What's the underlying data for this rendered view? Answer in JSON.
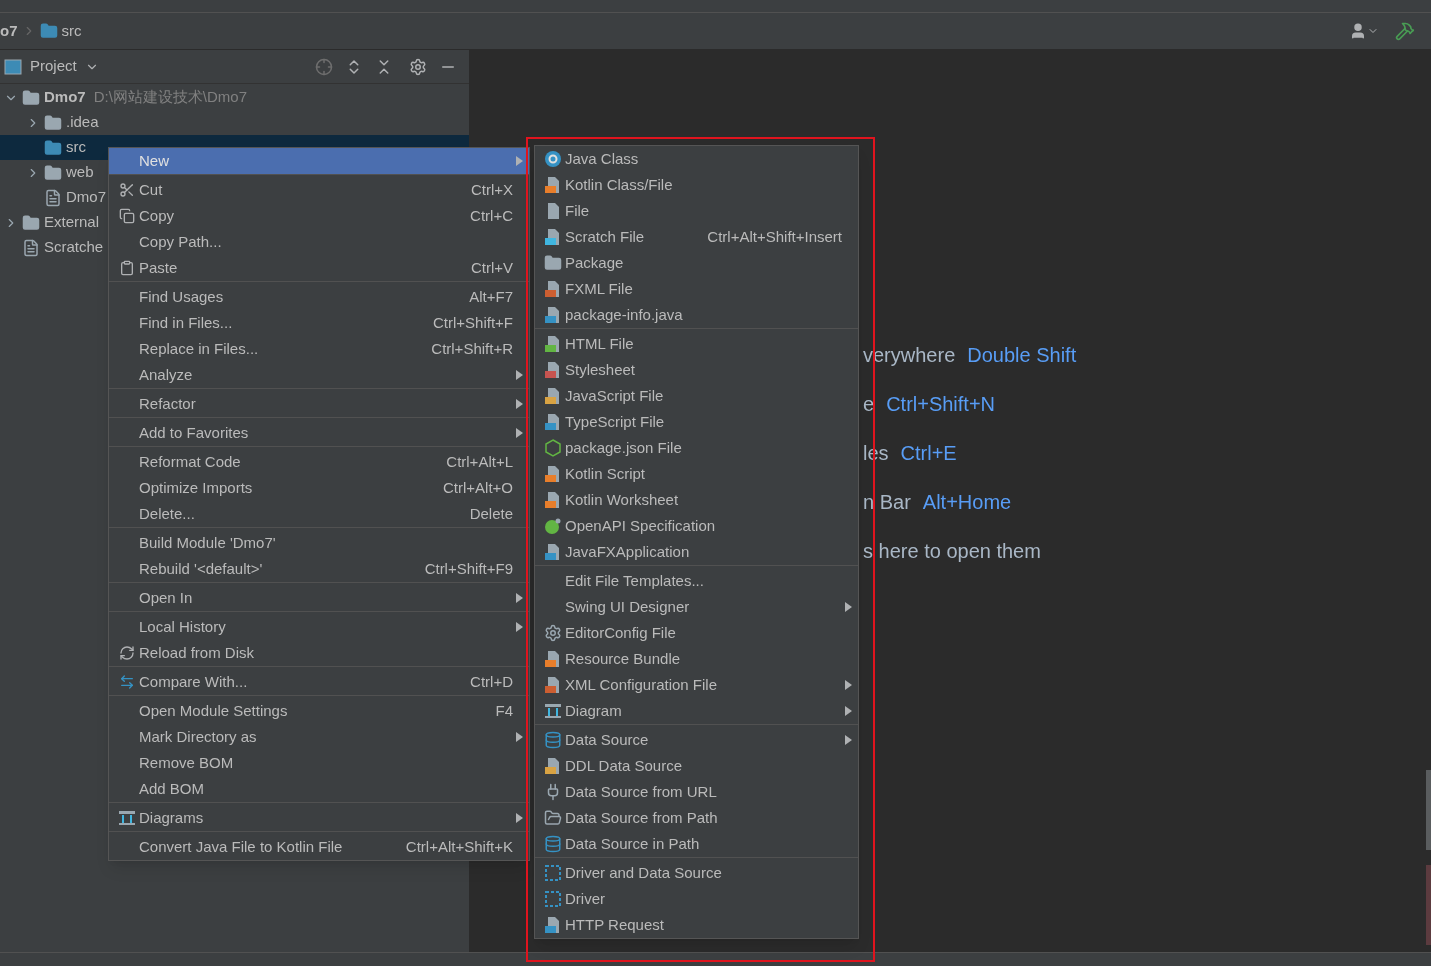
{
  "breadcrumb": [
    {
      "label": "o7",
      "bold": true
    },
    {
      "label": "src",
      "bold": false
    }
  ],
  "project_panel": {
    "title": "Project"
  },
  "tree": [
    {
      "label": "Dmo7",
      "path": "D:\\网站建设技术\\Dmo7",
      "expanded": true,
      "selected": false,
      "children": [
        {
          "label": ".idea",
          "expanded": false,
          "selected": false
        },
        {
          "label": "src",
          "selected": true
        },
        {
          "label": "web",
          "expanded": false,
          "selected": false
        },
        {
          "label": "Dmo7",
          "selected": false
        }
      ]
    },
    {
      "label": "External",
      "expanded": false,
      "selected": false
    },
    {
      "label": "Scratche",
      "selected": false
    }
  ],
  "context_menu": {
    "groups": [
      {
        "items": [
          {
            "label": "New",
            "submenu": true,
            "selected": true
          }
        ]
      },
      {
        "items": [
          {
            "label": "Cut",
            "shortcut": "Ctrl+X",
            "submenu": false,
            "selected": false
          },
          {
            "label": "Copy",
            "shortcut": "Ctrl+C",
            "submenu": false,
            "selected": false
          },
          {
            "label": "Copy Path...",
            "submenu": false,
            "selected": false
          },
          {
            "label": "Paste",
            "shortcut": "Ctrl+V",
            "submenu": false,
            "selected": false
          }
        ]
      },
      {
        "items": [
          {
            "label": "Find Usages",
            "shortcut": "Alt+F7",
            "submenu": false,
            "selected": false
          },
          {
            "label": "Find in Files...",
            "shortcut": "Ctrl+Shift+F",
            "submenu": false,
            "selected": false
          },
          {
            "label": "Replace in Files...",
            "shortcut": "Ctrl+Shift+R",
            "submenu": false,
            "selected": false
          },
          {
            "label": "Analyze",
            "submenu": true,
            "selected": false
          }
        ]
      },
      {
        "items": [
          {
            "label": "Refactor",
            "submenu": true,
            "selected": false
          }
        ]
      },
      {
        "items": [
          {
            "label": "Add to Favorites",
            "submenu": true,
            "selected": false
          }
        ]
      },
      {
        "items": [
          {
            "label": "Reformat Code",
            "shortcut": "Ctrl+Alt+L",
            "submenu": false,
            "selected": false
          },
          {
            "label": "Optimize Imports",
            "shortcut": "Ctrl+Alt+O",
            "submenu": false,
            "selected": false
          },
          {
            "label": "Delete...",
            "shortcut": "Delete",
            "submenu": false,
            "selected": false
          }
        ]
      },
      {
        "items": [
          {
            "label": "Build Module 'Dmo7'",
            "submenu": false,
            "selected": false
          },
          {
            "label": "Rebuild '<default>'",
            "shortcut": "Ctrl+Shift+F9",
            "submenu": false,
            "selected": false
          }
        ]
      },
      {
        "items": [
          {
            "label": "Open In",
            "submenu": true,
            "selected": false
          }
        ]
      },
      {
        "items": [
          {
            "label": "Local History",
            "submenu": true,
            "selected": false
          },
          {
            "label": "Reload from Disk",
            "submenu": false,
            "selected": false
          }
        ]
      },
      {
        "items": [
          {
            "label": "Compare With...",
            "shortcut": "Ctrl+D",
            "submenu": false,
            "selected": false
          }
        ]
      },
      {
        "items": [
          {
            "label": "Open Module Settings",
            "shortcut": "F4",
            "submenu": false,
            "selected": false
          },
          {
            "label": "Mark Directory as",
            "submenu": true,
            "selected": false
          },
          {
            "label": "Remove BOM",
            "submenu": false,
            "selected": false
          },
          {
            "label": "Add BOM",
            "submenu": false,
            "selected": false
          }
        ]
      },
      {
        "items": [
          {
            "label": "Diagrams",
            "submenu": true,
            "selected": false
          }
        ]
      },
      {
        "items": [
          {
            "label": "Convert Java File to Kotlin File",
            "shortcut": "Ctrl+Alt+Shift+K",
            "submenu": false,
            "selected": false
          }
        ]
      }
    ]
  },
  "new_submenu": {
    "groups": [
      {
        "items": [
          {
            "label": "Java Class",
            "submenu": false,
            "selected": false
          },
          {
            "label": "Kotlin Class/File",
            "submenu": false,
            "selected": false
          },
          {
            "label": "File",
            "submenu": false,
            "selected": false
          },
          {
            "label": "Scratch File",
            "shortcut": "Ctrl+Alt+Shift+Insert",
            "submenu": false,
            "selected": false
          },
          {
            "label": "Package",
            "submenu": false,
            "selected": false
          },
          {
            "label": "FXML File",
            "submenu": false,
            "selected": false
          },
          {
            "label": "package-info.java",
            "submenu": false,
            "selected": false
          }
        ]
      },
      {
        "items": [
          {
            "label": "HTML File",
            "submenu": false,
            "selected": false
          },
          {
            "label": "Stylesheet",
            "submenu": false,
            "selected": false
          },
          {
            "label": "JavaScript File",
            "submenu": false,
            "selected": false
          },
          {
            "label": "TypeScript File",
            "submenu": false,
            "selected": false
          },
          {
            "label": "package.json File",
            "submenu": false,
            "selected": false
          },
          {
            "label": "Kotlin Script",
            "submenu": false,
            "selected": false
          },
          {
            "label": "Kotlin Worksheet",
            "submenu": false,
            "selected": false
          },
          {
            "label": "OpenAPI Specification",
            "submenu": false,
            "selected": false
          },
          {
            "label": "JavaFXApplication",
            "submenu": false,
            "selected": false
          }
        ]
      },
      {
        "items": [
          {
            "label": "Edit File Templates...",
            "submenu": false,
            "selected": false
          },
          {
            "label": "Swing UI Designer",
            "submenu": true,
            "selected": false
          },
          {
            "label": "EditorConfig File",
            "submenu": false,
            "selected": false
          },
          {
            "label": "Resource Bundle",
            "submenu": false,
            "selected": false
          },
          {
            "label": "XML Configuration File",
            "submenu": true,
            "selected": false
          },
          {
            "label": "Diagram",
            "submenu": true,
            "selected": false
          }
        ]
      },
      {
        "items": [
          {
            "label": "Data Source",
            "submenu": true,
            "selected": false
          },
          {
            "label": "DDL Data Source",
            "submenu": false,
            "selected": false
          },
          {
            "label": "Data Source from URL",
            "submenu": false,
            "selected": false
          },
          {
            "label": "Data Source from Path",
            "submenu": false,
            "selected": false
          },
          {
            "label": "Data Source in Path",
            "submenu": false,
            "selected": false
          }
        ]
      },
      {
        "items": [
          {
            "label": "Driver and Data Source",
            "submenu": false,
            "selected": false
          },
          {
            "label": "Driver",
            "submenu": false,
            "selected": false
          },
          {
            "label": "HTTP Request",
            "submenu": false,
            "selected": false
          }
        ]
      }
    ]
  },
  "editor_hints": [
    {
      "text": "verywhere",
      "key": "Double Shift"
    },
    {
      "text": "e",
      "key": "Ctrl+Shift+N"
    },
    {
      "text": "les",
      "key": "Ctrl+E"
    },
    {
      "text": "n Bar",
      "key": "Alt+Home"
    },
    {
      "text": "s here to open them"
    }
  ]
}
